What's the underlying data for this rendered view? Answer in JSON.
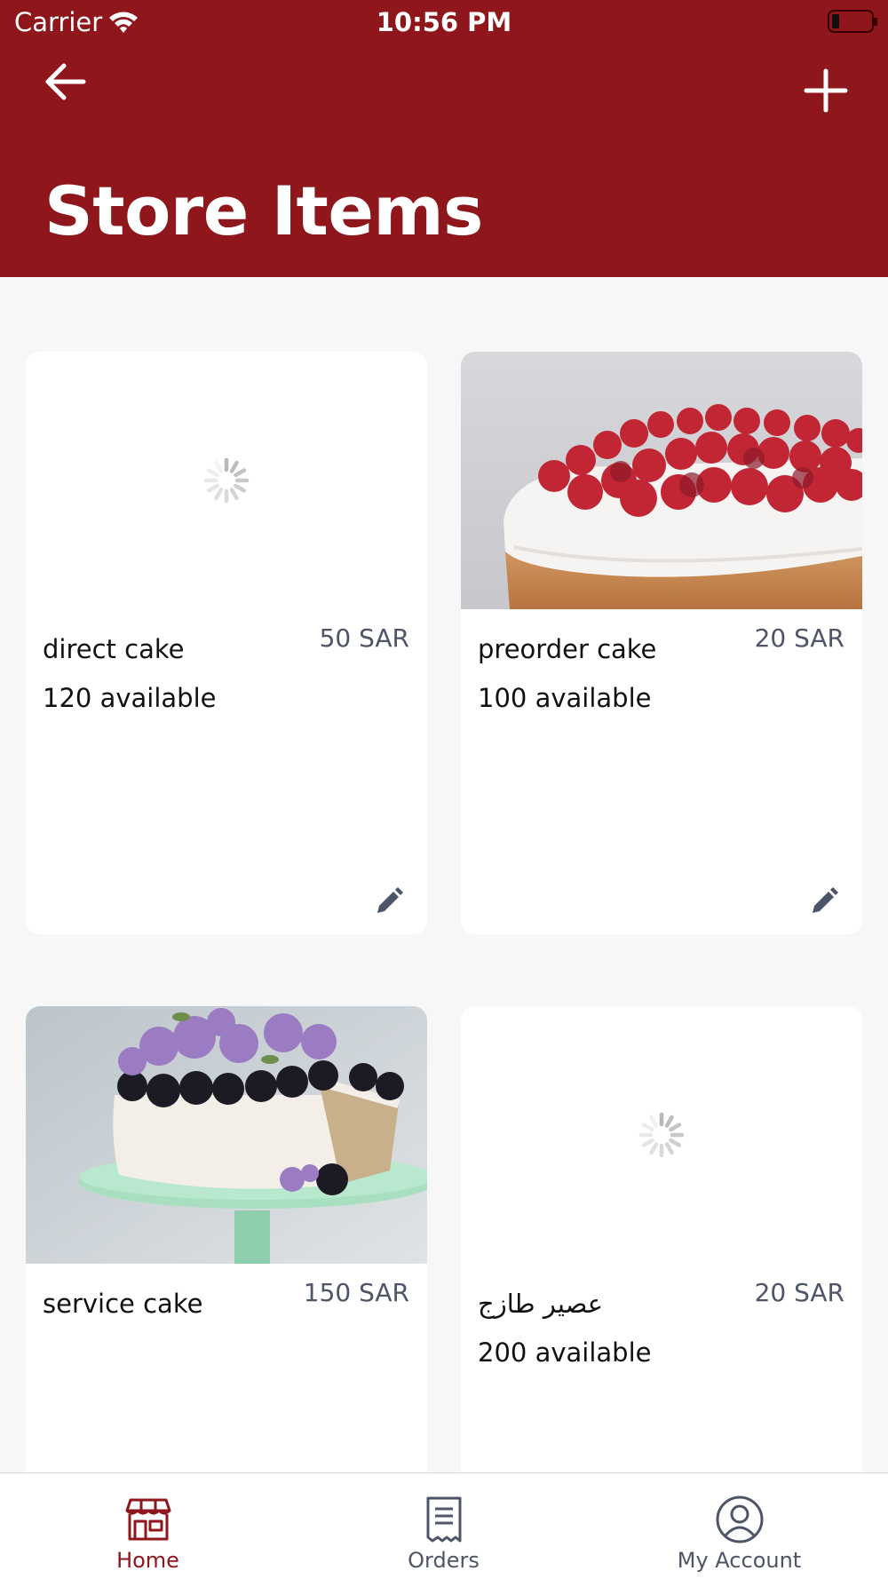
{
  "status_bar": {
    "carrier": "Carrier",
    "time": "10:56 PM"
  },
  "header": {
    "title": "Store Items",
    "back_icon": "arrow-left-icon",
    "add_icon": "plus-icon"
  },
  "colors": {
    "brand": "#8f161b",
    "background": "#f7f7f7",
    "muted_text": "#4d5566"
  },
  "items": [
    {
      "name": "direct cake",
      "price": "50 SAR",
      "stock": "120 available",
      "image": "loading-spinner"
    },
    {
      "name": "preorder cake",
      "price": "20 SAR",
      "stock": "100 available",
      "image": "raspberry-cake-photo"
    },
    {
      "name": "service cake",
      "price": "150 SAR",
      "stock": "",
      "image": "blackberry-lilac-cake-photo"
    },
    {
      "name": "عصير طازج",
      "price": "20 SAR",
      "stock": "200 available",
      "image": "loading-spinner"
    }
  ],
  "tabs": [
    {
      "label": "Home",
      "icon": "storefront-icon",
      "active": true
    },
    {
      "label": "Orders",
      "icon": "receipt-icon",
      "active": false
    },
    {
      "label": "My Account",
      "icon": "user-circle-icon",
      "active": false
    }
  ]
}
